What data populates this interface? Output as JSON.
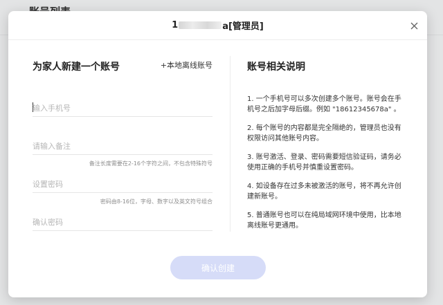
{
  "background": {
    "page_title": "账号列表"
  },
  "modal": {
    "title_prefix": "1",
    "title_suffix": "a[管理员]",
    "form_title": "为家人新建一个账号",
    "offline_link": "+本地离线账号",
    "fields": {
      "phone": {
        "placeholder": "输入手机号"
      },
      "remark": {
        "placeholder": "请输入备注",
        "hint": "备注长度需要在2-16个字符之间，不包含特殊符号"
      },
      "password": {
        "placeholder": "设置密码",
        "hint": "密码由8-16位，字母、数字以及英文符号组合"
      },
      "confirm": {
        "placeholder": "确认密码"
      }
    },
    "info_title": "账号相关说明",
    "notes": [
      "1. 一个手机号可以多次创建多个账号。账号会在手机号之后加字母后缀。例如 \"18612345678a\" 。",
      "2. 每个账号的内容都是完全隔绝的，管理员也没有权限访问其他账号内容。",
      "3. 账号激活、登录、密码需要短信验证码，请务必使用正确的手机号并慎重设置密码。",
      "4. 如设备存在过多未被激活的账号，将不再允许创建新账号。",
      "5. 普通账号也可以在纯局域网环境中使用，比本地离线账号更通用。"
    ],
    "submit_label": "确认创建",
    "colors": {
      "submit_disabled": "#d6dcf8"
    }
  }
}
